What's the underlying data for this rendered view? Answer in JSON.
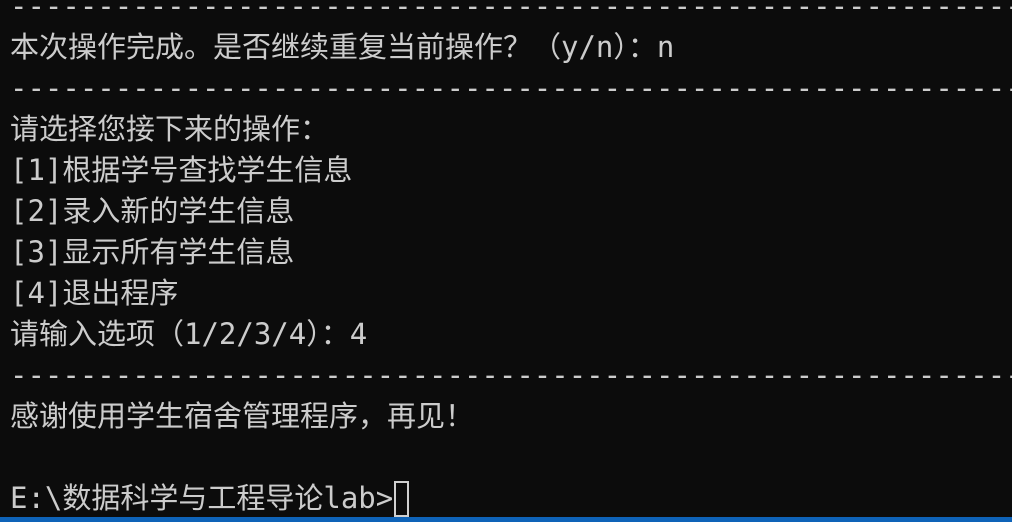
{
  "terminal": {
    "separator": "------------------------------------------------------------",
    "lines": {
      "l1_separator": "------------------------------------------------------------",
      "l2_continue_prompt": "本次操作完成。是否继续重复当前操作？（y/n）：n",
      "l3_separator": "------------------------------------------------------------",
      "l4_menu_title": "请选择您接下来的操作：",
      "l5_option1": "[1]根据学号查找学生信息",
      "l6_option2": "[2]录入新的学生信息",
      "l7_option3": "[3]显示所有学生信息",
      "l8_option4": "[4]退出程序",
      "l9_input_prompt": "请输入选项（1/2/3/4）：4",
      "l10_separator": "------------------------------------------------------------",
      "l11_goodbye": "感谢使用学生宿舍管理程序，再见！",
      "l12_blank": "",
      "l13_shell_prompt": "E:\\数据科学与工程导论lab>"
    },
    "colors": {
      "background": "#0c0c0c",
      "foreground": "#cccccc",
      "statusbar": "#0e63b8"
    }
  }
}
